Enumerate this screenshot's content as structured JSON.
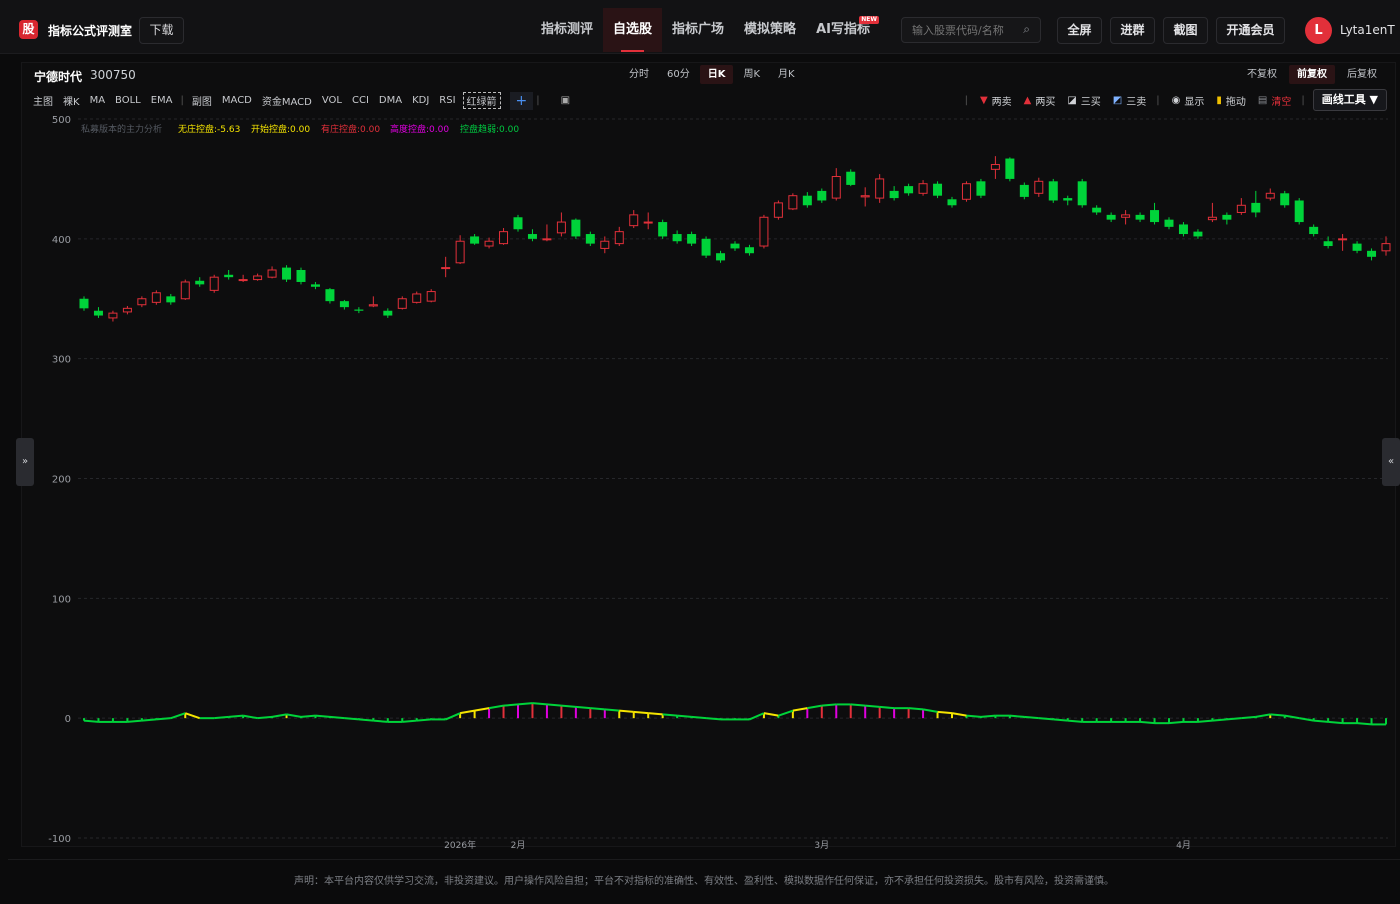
{
  "header": {
    "logo_char": "股",
    "site_title": "指标公式评测室",
    "download_label": "下载",
    "nav": [
      {
        "label": "指标测评",
        "active": false
      },
      {
        "label": "自选股",
        "active": true
      },
      {
        "label": "指标广场",
        "active": false
      },
      {
        "label": "模拟策略",
        "active": false
      },
      {
        "label": "AI写指标",
        "active": false,
        "badge": "NEW"
      }
    ],
    "search_placeholder": "输入股票代码/名称",
    "fullscreen_label": "全屏",
    "join_group_label": "进群",
    "screenshot_label": "截图",
    "vip_label": "开通会员",
    "avatar_letter": "L",
    "username": "Lyta1enT"
  },
  "stock": {
    "name": "宁德时代",
    "code": "300750"
  },
  "periods": [
    {
      "label": "分时",
      "active": false
    },
    {
      "label": "60分",
      "active": false
    },
    {
      "label": "日K",
      "active": true
    },
    {
      "label": "周K",
      "active": false
    },
    {
      "label": "月K",
      "active": false
    }
  ],
  "adjust": [
    {
      "label": "不复权",
      "active": false
    },
    {
      "label": "前复权",
      "active": true
    },
    {
      "label": "后复权",
      "active": false
    }
  ],
  "indicators_main": [
    "主图",
    "裸K",
    "MA",
    "BOLL",
    "EMA"
  ],
  "indicators_sub": [
    "副图",
    "MACD",
    "资金MACD",
    "VOL",
    "CCI",
    "DMA",
    "KDJ",
    "RSI"
  ],
  "indicator_selected": "红绿箭",
  "add_label": "+",
  "tools": {
    "two_sell": "两卖",
    "two_buy": "两买",
    "three_buy": "三买",
    "three_sell": "三卖",
    "show": "显示",
    "drag": "拖动",
    "clear": "清空",
    "draw_tools": "画线工具 ▼"
  },
  "colors": {
    "up": "#e2303a",
    "down": "#00d33a",
    "legend_title": "#555a62",
    "no_control": "#f5e400",
    "start_control": "#f5e400",
    "has_control": "#e2303a",
    "high_control": "#e000e0",
    "weak_control": "#00c840"
  },
  "chart_legend": {
    "title": "私募版本的主力分析",
    "items": [
      {
        "label": "无庄控盘:",
        "value": "-5.63",
        "color": "#f5e400"
      },
      {
        "label": "开始控盘:",
        "value": "0.00",
        "color": "#f5e400"
      },
      {
        "label": "有庄控盘:",
        "value": "0.00",
        "color": "#e2303a"
      },
      {
        "label": "高度控盘:",
        "value": "0.00",
        "color": "#e000e0"
      },
      {
        "label": "控盘趋弱:",
        "value": "0.00",
        "color": "#00c840"
      }
    ]
  },
  "chart_data": {
    "type": "candlestick",
    "ylim": [
      -100,
      500
    ],
    "yticks": [
      500,
      400,
      300,
      200,
      100,
      0,
      -100
    ],
    "x_labels": [
      "2026年",
      "2月",
      "3月",
      "4月"
    ],
    "candles": [
      [
        350,
        342,
        352,
        340
      ],
      [
        340,
        336,
        343,
        334
      ],
      [
        334,
        338,
        340,
        331
      ],
      [
        339,
        342,
        344,
        337
      ],
      [
        345,
        350,
        352,
        343
      ],
      [
        347,
        355,
        357,
        345
      ],
      [
        352,
        347,
        354,
        345
      ],
      [
        350,
        364,
        366,
        349
      ],
      [
        365,
        362,
        368,
        360
      ],
      [
        357,
        368,
        370,
        355
      ],
      [
        370,
        368,
        374,
        366
      ],
      [
        366,
        366,
        370,
        364
      ],
      [
        366,
        369,
        371,
        365
      ],
      [
        368,
        374,
        377,
        367
      ],
      [
        376,
        366,
        378,
        364
      ],
      [
        374,
        364,
        376,
        362
      ],
      [
        362,
        360,
        364,
        358
      ],
      [
        358,
        348,
        359,
        346
      ],
      [
        348,
        343,
        349,
        341
      ],
      [
        341,
        340,
        343,
        338
      ],
      [
        344,
        345,
        352,
        343
      ],
      [
        340,
        336,
        342,
        334
      ],
      [
        342,
        350,
        352,
        341
      ],
      [
        347,
        354,
        356,
        346
      ],
      [
        348,
        356,
        358,
        347
      ],
      [
        376,
        376,
        385,
        368
      ],
      [
        380,
        398,
        403,
        379
      ],
      [
        402,
        396,
        404,
        395
      ],
      [
        394,
        398,
        401,
        392
      ],
      [
        396,
        406,
        409,
        395
      ],
      [
        418,
        408,
        420,
        406
      ],
      [
        404,
        400,
        408,
        398
      ],
      [
        400,
        400,
        412,
        398
      ],
      [
        405,
        414,
        422,
        402
      ],
      [
        416,
        402,
        417,
        400
      ],
      [
        404,
        396,
        406,
        394
      ],
      [
        392,
        398,
        402,
        388
      ],
      [
        396,
        406,
        410,
        394
      ],
      [
        411,
        420,
        424,
        409
      ],
      [
        414,
        414,
        422,
        408
      ],
      [
        414,
        402,
        416,
        400
      ],
      [
        404,
        398,
        407,
        396
      ],
      [
        404,
        396,
        406,
        394
      ],
      [
        400,
        386,
        402,
        384
      ],
      [
        388,
        382,
        390,
        380
      ],
      [
        396,
        392,
        398,
        390
      ],
      [
        393,
        388,
        395,
        386
      ],
      [
        394,
        418,
        420,
        392
      ],
      [
        418,
        430,
        432,
        416
      ],
      [
        425,
        436,
        438,
        424
      ],
      [
        436,
        428,
        439,
        426
      ],
      [
        440,
        432,
        442,
        430
      ],
      [
        434,
        452,
        459,
        432
      ],
      [
        456,
        445,
        458,
        444
      ],
      [
        435,
        436,
        443,
        427
      ],
      [
        434,
        450,
        454,
        430
      ],
      [
        440,
        434,
        444,
        432
      ],
      [
        444,
        438,
        446,
        436
      ],
      [
        438,
        446,
        449,
        436
      ],
      [
        446,
        436,
        448,
        434
      ],
      [
        433,
        428,
        435,
        426
      ],
      [
        433,
        446,
        448,
        431
      ],
      [
        448,
        436,
        450,
        434
      ],
      [
        458,
        462,
        469,
        450
      ],
      [
        467,
        450,
        468,
        448
      ],
      [
        445,
        435,
        447,
        433
      ],
      [
        438,
        448,
        451,
        435
      ],
      [
        448,
        432,
        450,
        430
      ],
      [
        434,
        432,
        436,
        428
      ],
      [
        448,
        428,
        450,
        426
      ],
      [
        426,
        422,
        428,
        420
      ],
      [
        420,
        416,
        422,
        414
      ],
      [
        418,
        420,
        424,
        412
      ],
      [
        420,
        416,
        422,
        414
      ],
      [
        424,
        414,
        430,
        412
      ],
      [
        416,
        410,
        418,
        408
      ],
      [
        412,
        404,
        414,
        402
      ],
      [
        406,
        402,
        408,
        400
      ],
      [
        416,
        418,
        430,
        414
      ],
      [
        420,
        416,
        422,
        412
      ],
      [
        422,
        428,
        434,
        420
      ],
      [
        430,
        422,
        440,
        418
      ],
      [
        434,
        438,
        442,
        432
      ],
      [
        438,
        428,
        440,
        426
      ],
      [
        432,
        414,
        434,
        412
      ],
      [
        410,
        404,
        412,
        402
      ],
      [
        398,
        394,
        402,
        392
      ],
      [
        400,
        400,
        404,
        390
      ],
      [
        396,
        390,
        398,
        388
      ],
      [
        390,
        385,
        392,
        382
      ],
      [
        390,
        396,
        402,
        386
      ]
    ],
    "indicator_series": {
      "name": "控盘",
      "color_yellow": "#f5e400",
      "color_green": "#00d33a",
      "color_red": "#e2303a",
      "color_magenta": "#e000e0",
      "values": [
        -2,
        -3,
        -3,
        -3,
        -2,
        -1,
        0,
        4,
        0,
        0,
        1,
        2,
        0,
        1,
        3,
        1,
        2,
        1,
        0,
        -1,
        -2,
        -3,
        -3,
        -2,
        -1,
        -1,
        4,
        6,
        8,
        10,
        11,
        12,
        11,
        10,
        9,
        8,
        7,
        6,
        5,
        4,
        3,
        2,
        1,
        0,
        -1,
        -1,
        -1,
        4,
        2,
        6,
        8,
        10,
        11,
        11,
        10,
        9,
        8,
        8,
        7,
        5,
        4,
        2,
        1,
        2,
        2,
        1,
        0,
        -1,
        -2,
        -3,
        -3,
        -3,
        -3,
        -3,
        -4,
        -4,
        -3,
        -3,
        -2,
        -1,
        0,
        1,
        3,
        2,
        0,
        -2,
        -3,
        -4,
        -4,
        -5,
        -5
      ]
    }
  },
  "footer": "声明：本平台内容仅供学习交流，非投资建议。用户操作风险自担；平台不对指标的准确性、有效性、盈利性、模拟数据作任何保证，亦不承担任何投资损失。股市有风险，投资需谨慎。"
}
